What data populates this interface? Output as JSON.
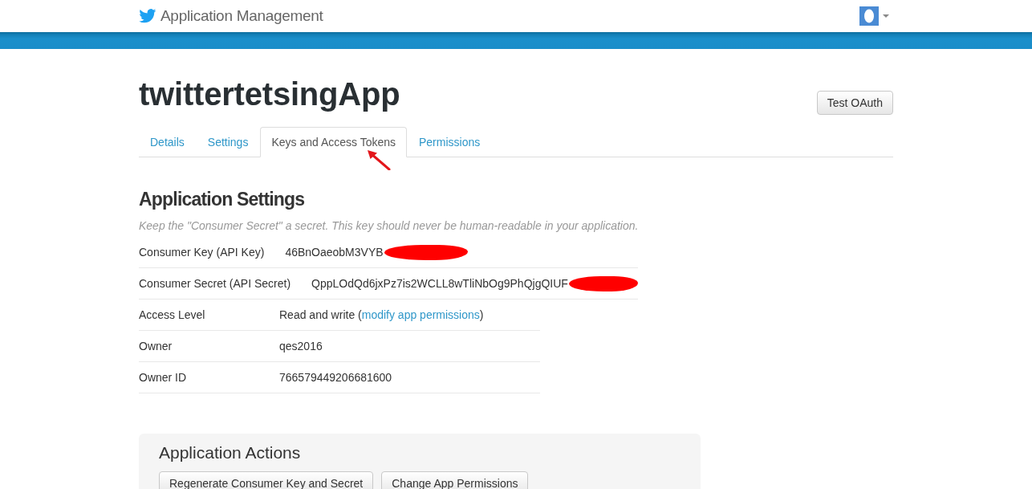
{
  "header": {
    "title": "Application Management"
  },
  "app": {
    "name": "twittertetsingApp",
    "test_button": "Test OAuth"
  },
  "tabs": [
    {
      "label": "Details",
      "selected": false
    },
    {
      "label": "Settings",
      "selected": false
    },
    {
      "label": "Keys and Access Tokens",
      "selected": true
    },
    {
      "label": "Permissions",
      "selected": false
    }
  ],
  "settings": {
    "heading": "Application Settings",
    "note": "Keep the \"Consumer Secret\" a secret. This key should never be human-readable in your application.",
    "rows": [
      {
        "kind": "secret",
        "label": "Consumer Key (API Key)",
        "value": "46BnOaeobM3VYB"
      },
      {
        "kind": "secret",
        "label": "Consumer Secret (API Secret)",
        "value": "QppLOdQd6jxPz7is2WCLL8wTliNbOg9PhQjgQIUF"
      },
      {
        "kind": "link",
        "label": "Access Level",
        "value": "Read and write (",
        "link": "modify app permissions",
        "value_end": ")"
      },
      {
        "kind": "text",
        "label": "Owner",
        "value": "qes2016"
      },
      {
        "kind": "text",
        "label": "Owner ID",
        "value": "766579449206681600"
      }
    ]
  },
  "actions": {
    "heading": "Application Actions",
    "buttons": [
      "Regenerate Consumer Key and Secret",
      "Change App Permissions"
    ]
  }
}
